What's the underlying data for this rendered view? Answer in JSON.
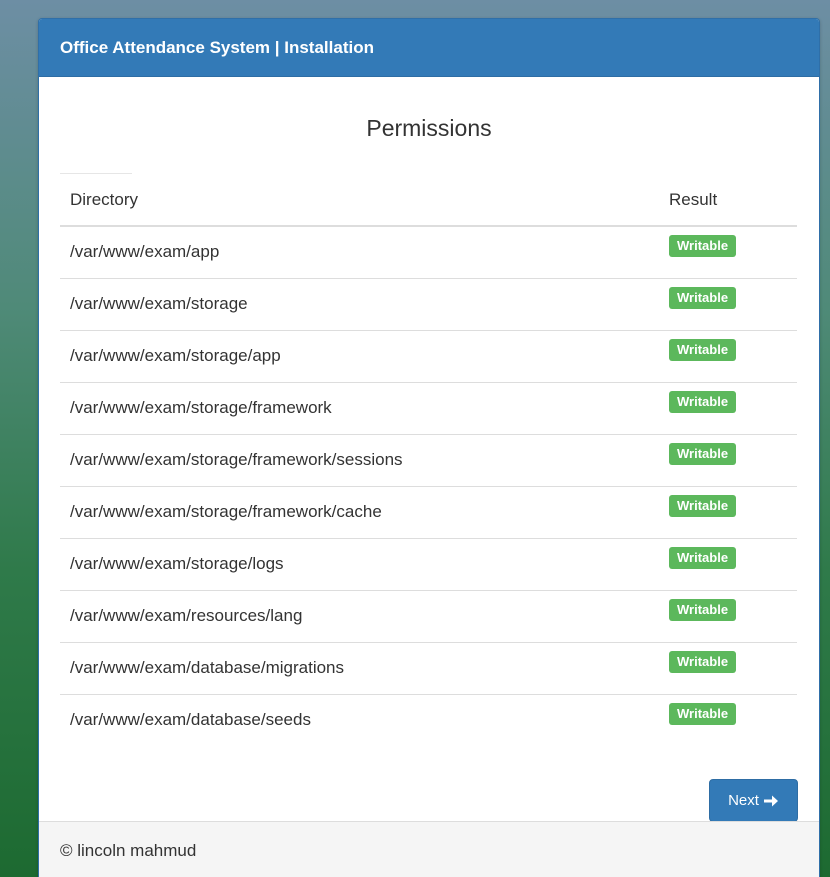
{
  "header": {
    "title": "Office Attendance System | Installation"
  },
  "main": {
    "section_title": "Permissions",
    "table": {
      "columns": [
        "Directory",
        "Result"
      ],
      "rows": [
        {
          "directory": "/var/www/exam/app",
          "result": "Writable"
        },
        {
          "directory": "/var/www/exam/storage",
          "result": "Writable"
        },
        {
          "directory": "/var/www/exam/storage/app",
          "result": "Writable"
        },
        {
          "directory": "/var/www/exam/storage/framework",
          "result": "Writable"
        },
        {
          "directory": "/var/www/exam/storage/framework/sessions",
          "result": "Writable"
        },
        {
          "directory": "/var/www/exam/storage/framework/cache",
          "result": "Writable"
        },
        {
          "directory": "/var/www/exam/storage/logs",
          "result": "Writable"
        },
        {
          "directory": "/var/www/exam/resources/lang",
          "result": "Writable"
        },
        {
          "directory": "/var/www/exam/database/migrations",
          "result": "Writable"
        },
        {
          "directory": "/var/www/exam/database/seeds",
          "result": "Writable"
        }
      ]
    },
    "next_button": {
      "label": "Next",
      "icon": "arrow-right-icon"
    }
  },
  "footer": {
    "text": "© lincoln mahmud"
  },
  "colors": {
    "primary": "#337ab7",
    "success": "#5cb85c",
    "footer_bg": "#f5f5f5"
  }
}
